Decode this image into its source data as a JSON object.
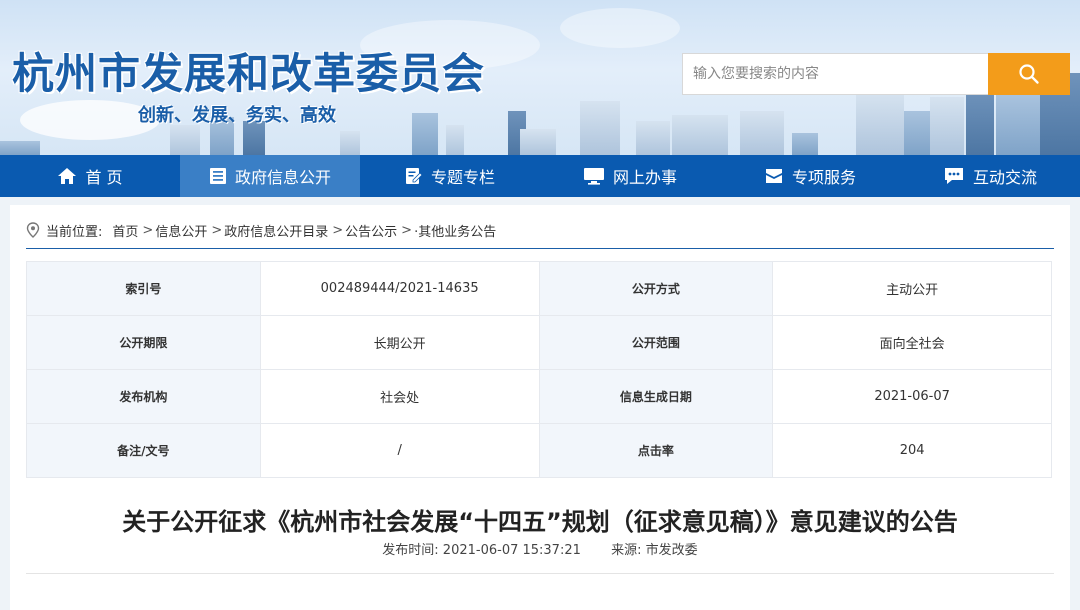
{
  "header": {
    "site_title": "杭州市发展和改革委员会",
    "slogan": "创新、发展、务实、高效",
    "search_placeholder": "输入您要搜索的内容"
  },
  "nav": {
    "items": [
      {
        "label": "首 页",
        "icon": "home-icon"
      },
      {
        "label": "政府信息公开",
        "icon": "document-list-icon"
      },
      {
        "label": "专题专栏",
        "icon": "edit-note-icon"
      },
      {
        "label": "网上办事",
        "icon": "monitor-icon"
      },
      {
        "label": "专项服务",
        "icon": "mail-icon"
      },
      {
        "label": "互动交流",
        "icon": "chat-icon"
      }
    ],
    "active_index": 1
  },
  "breadcrumb": {
    "prefix": "当前位置:",
    "items": [
      "首页",
      "信息公开",
      "政府信息公开目录",
      "公告公示",
      "·其他业务公告"
    ]
  },
  "meta_table": {
    "rows": [
      {
        "label1": "索引号",
        "value1": "002489444/2021-14635",
        "label2": "公开方式",
        "value2": "主动公开"
      },
      {
        "label1": "公开期限",
        "value1": "长期公开",
        "label2": "公开范围",
        "value2": "面向全社会"
      },
      {
        "label1": "发布机构",
        "value1": "社会处",
        "label2": "信息生成日期",
        "value2": "2021-06-07"
      },
      {
        "label1": "备注/文号",
        "value1": "/",
        "label2": "点击率",
        "value2": "204"
      }
    ]
  },
  "article": {
    "title": "关于公开征求《杭州市社会发展“十四五”规划（征求意见稿）》意见建议的公告",
    "publish_time": "发布时间: 2021-06-07 15:37:21",
    "source": "来源: 市发改委"
  },
  "colors": {
    "brand_blue": "#0a5ab0",
    "nav_active": "#3a7fc6",
    "search_orange": "#f39c1a"
  }
}
